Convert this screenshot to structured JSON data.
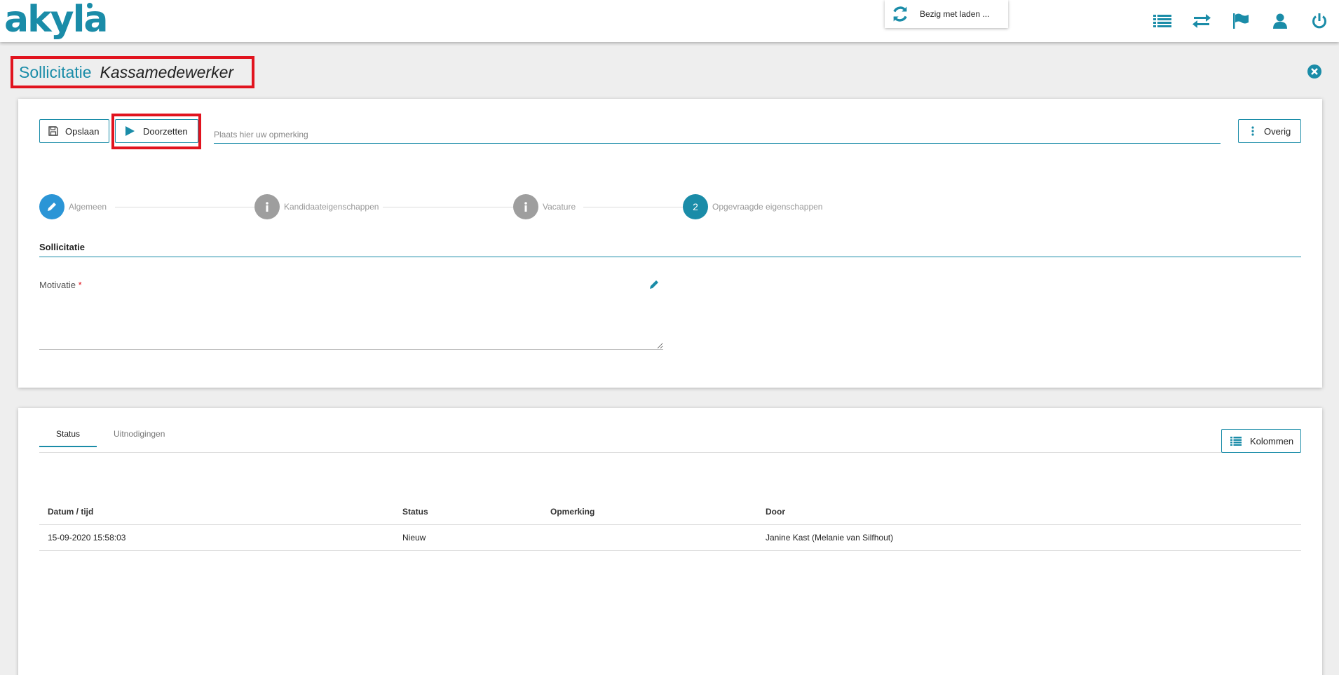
{
  "header": {
    "logo": "akyla",
    "loading_text": "Bezig met laden ...",
    "icons": [
      "list-icon",
      "swap-icon",
      "flag-icon",
      "user-icon",
      "power-icon"
    ]
  },
  "page": {
    "title": "Sollicitatie",
    "subtitle": "Kassamedewerker"
  },
  "toolbar": {
    "save_label": "Opslaan",
    "forward_label": "Doorzetten",
    "remark_placeholder": "Plaats hier uw opmerking",
    "more_label": "Overig"
  },
  "stepper": {
    "steps": [
      {
        "label": "Algemeen",
        "icon": "pencil-icon"
      },
      {
        "label": "Kandidaateigenschappen",
        "icon": "info-icon"
      },
      {
        "label": "Vacature",
        "icon": "info-icon"
      },
      {
        "label": "Opgevraagde eigenschappen",
        "badge": "2"
      }
    ]
  },
  "form": {
    "section_title": "Sollicitatie",
    "motivatie_label": "Motivatie",
    "required_mark": "*",
    "motivatie_value": ""
  },
  "history": {
    "tabs": [
      "Status",
      "Uitnodigingen"
    ],
    "columns_button": "Kolommen",
    "columns": [
      "Datum / tijd",
      "Status",
      "Opmerking",
      "Door"
    ],
    "rows": [
      [
        "15-09-2020 15:58:03",
        "Nieuw",
        "",
        "Janine Kast (Melanie van Silfhout)"
      ]
    ]
  },
  "colors": {
    "accent": "#1a8ca8",
    "highlight": "#e1131e",
    "step_active": "#2b95d6",
    "step_inactive": "#9e9e9e"
  }
}
